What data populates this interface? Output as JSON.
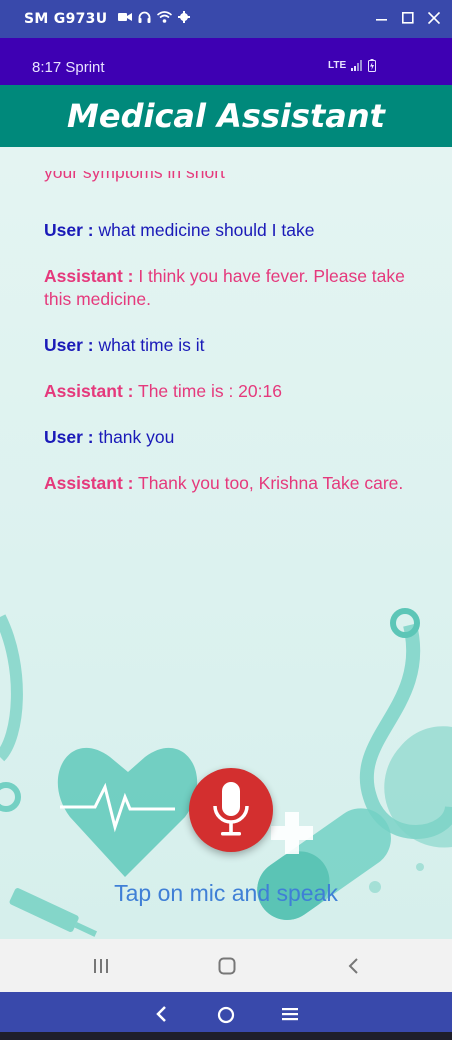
{
  "window": {
    "title": "SM G973U"
  },
  "status": {
    "time": "8:17 Sprint",
    "network": "LTE"
  },
  "app": {
    "title": "Medical Assistant"
  },
  "chat": {
    "cutoff": "your symptoms in short",
    "messages": [
      {
        "speaker": "User :",
        "text": " what medicine should I take"
      },
      {
        "speaker": "Assistant :",
        "text": " I think you have fever. Please take this medicine."
      },
      {
        "speaker": "User :",
        "text": " what time is it"
      },
      {
        "speaker": "Assistant :",
        "text": " The time is : 20:16"
      },
      {
        "speaker": "User :",
        "text": " thank you"
      },
      {
        "speaker": "Assistant :",
        "text": " Thank you too, Krishna Take care."
      }
    ]
  },
  "mic": {
    "label": "Tap on mic and speak"
  },
  "colors": {
    "appbar": "#00897b",
    "status": "#3e00b3",
    "window": "#3949ab",
    "user": "#1a1ab8",
    "assistant": "#e5397c",
    "mic": "#d32f2f",
    "hint": "#3f7fd6"
  }
}
